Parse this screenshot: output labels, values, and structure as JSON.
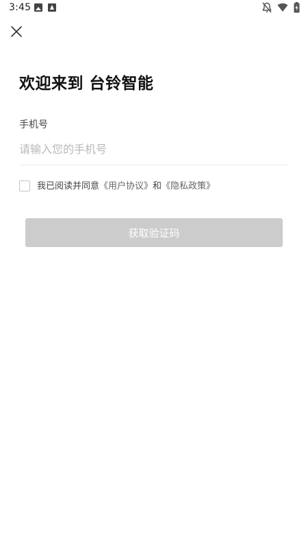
{
  "status_bar": {
    "time": "3:45",
    "left_icons": [
      "image-icon",
      "a-icon"
    ],
    "right_icons": [
      "notifications-off-icon",
      "wifi-icon",
      "battery-charging-icon"
    ]
  },
  "header": {
    "close_icon": "close-icon"
  },
  "main": {
    "title": "欢迎来到 台铃智能",
    "phone_label": "手机号",
    "phone_input": {
      "value": "",
      "placeholder": "请输入您的手机号"
    },
    "agreement": {
      "checked": false,
      "prefix": "我已阅读并同意",
      "user_agreement": "《用户协议》",
      "and": "和",
      "privacy_policy": "《隐私政策》"
    },
    "get_code_button": "获取验证码"
  },
  "colors": {
    "background": "#ffffff",
    "text_primary": "#111111",
    "placeholder": "#b8b8b8",
    "divider": "#ececec",
    "button_disabled": "#cccccc",
    "button_text": "#ffffff"
  }
}
